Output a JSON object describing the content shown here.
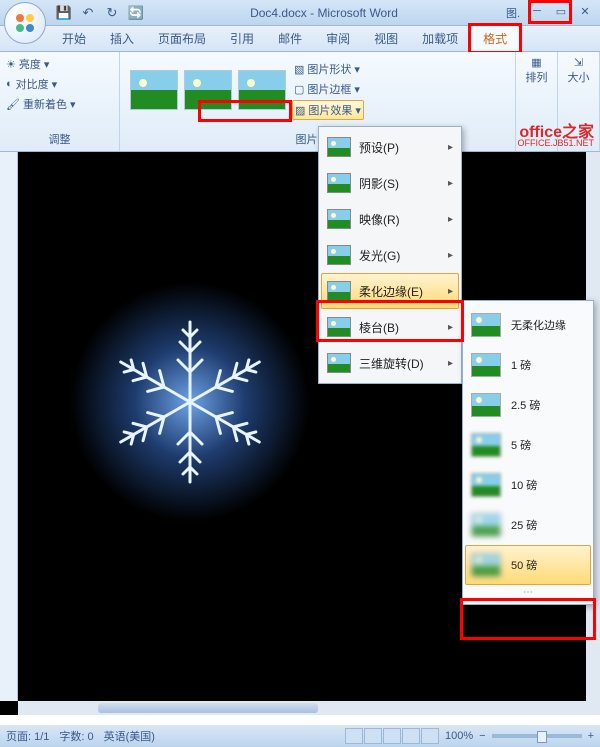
{
  "title": "Doc4.docx - Microsoft Word",
  "title_prefix": "图.",
  "qat": {
    "save": "💾",
    "undo": "↶",
    "redo": "↻",
    "refresh": "🔄"
  },
  "tabs": [
    "开始",
    "插入",
    "页面布局",
    "引用",
    "邮件",
    "审阅",
    "视图",
    "加载项",
    "格式"
  ],
  "ribbon": {
    "adjust": {
      "brightness": "亮度",
      "contrast": "对比度",
      "recolor": "重新着色",
      "label": "调整"
    },
    "styles": {
      "label": "图片样式",
      "shape": "图片形状",
      "border": "图片边框",
      "effects": "图片效果"
    },
    "arrange": {
      "label": "排列"
    },
    "size": {
      "label": "大小"
    }
  },
  "watermark": {
    "main": "office之家",
    "sub": "OFFICE.JB51.NET"
  },
  "effects_menu": [
    {
      "label": "预设(P)",
      "key": "preset"
    },
    {
      "label": "阴影(S)",
      "key": "shadow"
    },
    {
      "label": "映像(R)",
      "key": "reflection"
    },
    {
      "label": "发光(G)",
      "key": "glow"
    },
    {
      "label": "柔化边缘(E)",
      "key": "soft-edges",
      "highlighted": true
    },
    {
      "label": "棱台(B)",
      "key": "bevel"
    },
    {
      "label": "三维旋转(D)",
      "key": "3d-rotation"
    }
  ],
  "soft_edges_submenu": [
    {
      "label": "无柔化边缘",
      "soft": 0
    },
    {
      "label": "1 磅",
      "soft": 0
    },
    {
      "label": "2.5 磅",
      "soft": 0
    },
    {
      "label": "5 磅",
      "soft": 1
    },
    {
      "label": "10 磅",
      "soft": 1
    },
    {
      "label": "25 磅",
      "soft": 2
    },
    {
      "label": "50 磅",
      "soft": 2,
      "highlighted": true
    }
  ],
  "statusbar": {
    "page": "页面: 1/1",
    "words": "字数: 0",
    "lang": "英语(美国)",
    "zoom": "100%"
  }
}
